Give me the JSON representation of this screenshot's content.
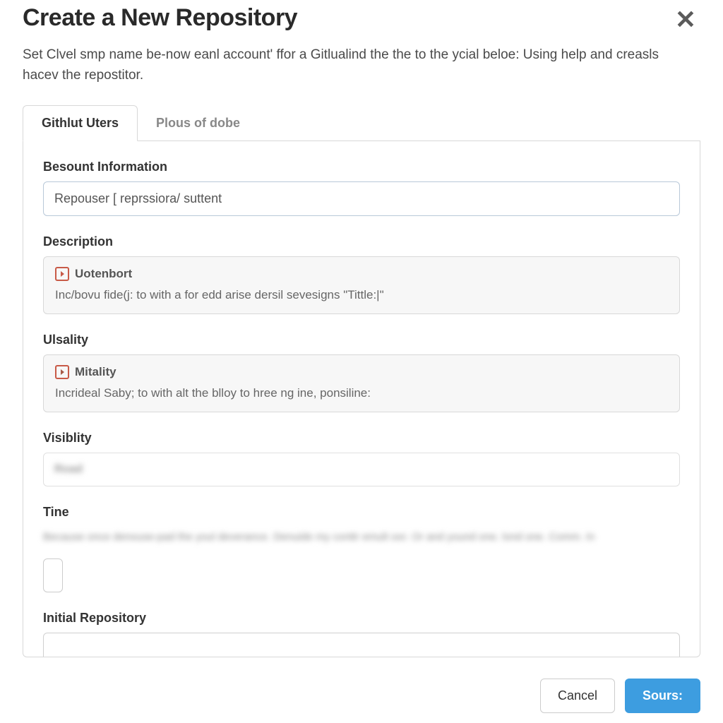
{
  "header": {
    "title": "Create a New Repository",
    "subtitle": "Set Clvel smp name be-now eanl account' ffor a Gitlualind the the to the ycial beloe: Using help and creasls hacev the repostitor."
  },
  "tabs": [
    {
      "label": "Githlut Uters",
      "active": true
    },
    {
      "label": "Plous of dobe",
      "active": false
    }
  ],
  "form": {
    "account_section": {
      "label": "Besount Information",
      "input_value": "Repouser [ reprssiora/ suttent"
    },
    "description_section": {
      "label": "Description",
      "card_title": "Uotenbort",
      "card_desc": "Inc/bovu fide(j: to with a for edd arise dersil sevesigns \"Tittle:|\""
    },
    "usability_section": {
      "label": "Ulsality",
      "card_title": "Mitality",
      "card_desc": "Incrideal Saby; to with alt the blloy to hree ng ine, ponsiline:"
    },
    "visibility_section": {
      "label": "Visiblity",
      "placeholder_blur": "Road"
    },
    "tine_section": {
      "label": "Tine",
      "blur_line": "Because once denouse-pad the youl deverance. Denuide my conttr emult oor. Or and yound one. lond one. Comm. In"
    },
    "initial_section": {
      "label": "Initial Repository"
    }
  },
  "footer": {
    "cancel": "Cancel",
    "submit": "Sours:"
  }
}
